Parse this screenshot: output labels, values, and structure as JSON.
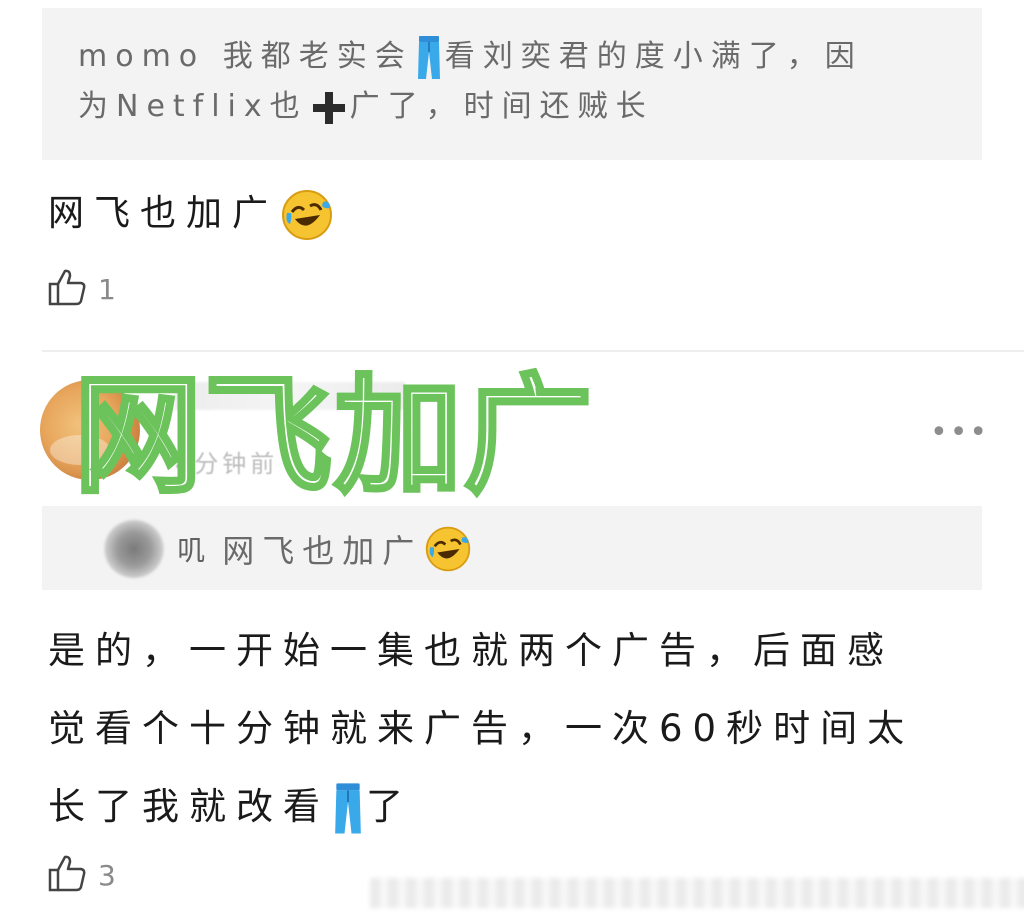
{
  "quote1": {
    "user": "momo",
    "part1": "我都老实会",
    "part2": "看刘奕君的度小满了，因",
    "part3": "为Netflix也",
    "part4": "广了，时间还贼长"
  },
  "comment1": {
    "text": "网飞也加广",
    "likes": "1"
  },
  "overlay_title": "网飞加广",
  "comment2": {
    "meta": "4分钟前",
    "more": "•••",
    "reply_name": "叽",
    "reply_text": "网飞也加广",
    "line1": "是的，一开始一集也就两个广告，后面感",
    "line2": "觉看个十分钟就来广告，一次60秒时间太",
    "line3": "长了我就改看",
    "line3_end": "了",
    "likes": "3"
  },
  "colors": {
    "overlay_green": "#6cc35c",
    "quote_bg": "#f3f3f3",
    "pants_blue": "#3aa9ea",
    "laugh_yellow": "#f6c331"
  }
}
